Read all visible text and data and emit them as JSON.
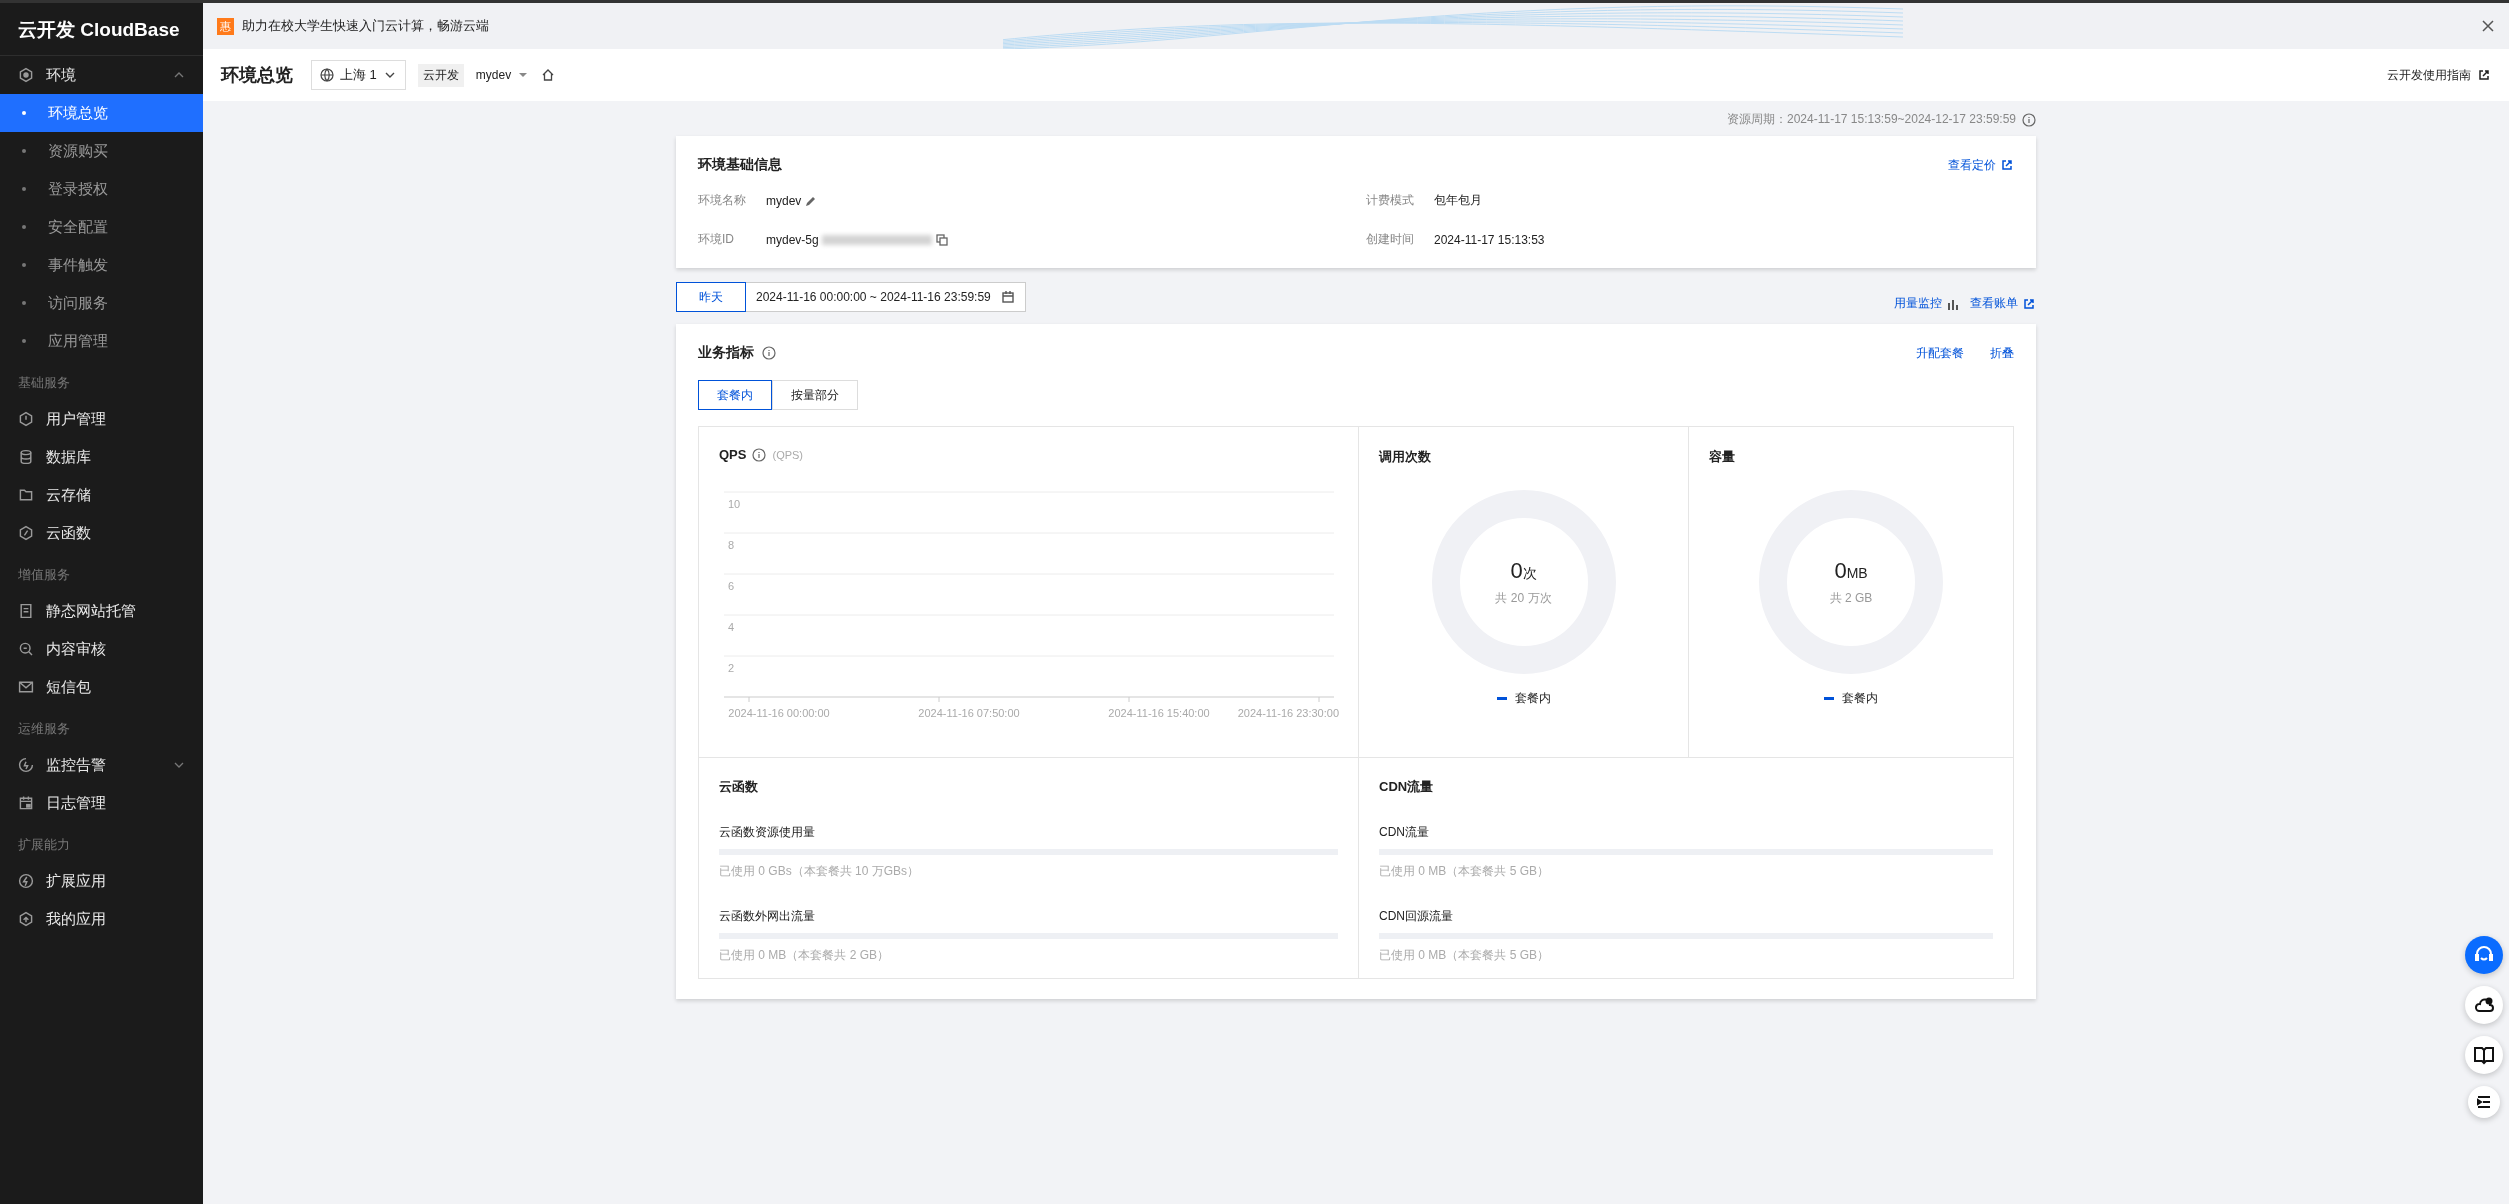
{
  "sidebar": {
    "brand": "云开发 CloudBase",
    "groups": [
      {
        "items": [
          {
            "label": "环境",
            "expanded": true,
            "children": [
              {
                "label": "环境总览",
                "selected": true
              },
              {
                "label": "资源购买",
                "selected": false
              },
              {
                "label": "登录授权",
                "selected": false
              },
              {
                "label": "安全配置",
                "selected": false
              },
              {
                "label": "事件触发",
                "selected": false
              },
              {
                "label": "访问服务",
                "selected": false
              },
              {
                "label": "应用管理",
                "selected": false
              }
            ]
          }
        ]
      },
      {
        "title": "基础服务",
        "items": [
          {
            "label": "用户管理"
          },
          {
            "label": "数据库"
          },
          {
            "label": "云存储"
          },
          {
            "label": "云函数"
          }
        ]
      },
      {
        "title": "增值服务",
        "items": [
          {
            "label": "静态网站托管"
          },
          {
            "label": "内容审核"
          },
          {
            "label": "短信包"
          }
        ]
      },
      {
        "title": "运维服务",
        "items": [
          {
            "label": "监控告警",
            "expanded": false
          },
          {
            "label": "日志管理"
          }
        ]
      },
      {
        "title": "扩展能力",
        "items": [
          {
            "label": "扩展应用"
          },
          {
            "label": "我的应用"
          }
        ]
      }
    ]
  },
  "banner": {
    "badge": "惠",
    "text": "助力在校大学生快速入门云计算，畅游云端"
  },
  "header": {
    "title": "环境总览",
    "region": "上海 1",
    "env_tag": "云开发",
    "env": "mydev",
    "guide_link": "云开发使用指南"
  },
  "resource_period": "资源周期：2024-11-17 15:13:59~2024-12-17 23:59:59",
  "env_card": {
    "title": "环境基础信息",
    "link": "查看定价",
    "fields": [
      {
        "label": "环境名称",
        "value": "mydev",
        "kind": "editable"
      },
      {
        "label": "计费模式",
        "value": "包年包月",
        "kind": "plain"
      },
      {
        "label": "环境ID",
        "value": "mydev-5g",
        "kind": "masked"
      },
      {
        "label": "创建时间",
        "value": "2024-11-17 15:13:53",
        "kind": "plain"
      }
    ]
  },
  "date_bar": {
    "quick": "昨天",
    "range": "2024-11-16 00:00:00 ~ 2024-11-16 23:59:59",
    "links": [
      {
        "label": "用量监控",
        "kind": "chart"
      },
      {
        "label": "查看账单",
        "kind": "external"
      }
    ]
  },
  "metrics": {
    "title": "业务指标",
    "actions": [
      "升配套餐",
      "折叠"
    ],
    "tabs": [
      {
        "label": "套餐内",
        "selected": true
      },
      {
        "label": "按量部分",
        "selected": false
      }
    ],
    "qps": {
      "title": "QPS",
      "unit": "(QPS)",
      "chart_data": {
        "type": "line",
        "grid": true,
        "ylim": [
          0,
          10
        ],
        "yticks": [
          2,
          4,
          6,
          8,
          10
        ],
        "x": [
          "2024-11-16 00:00:00",
          "2024-11-16 07:50:00",
          "2024-11-16 15:40:00",
          "2024-11-16 23:30:00"
        ]
      }
    },
    "donuts": [
      {
        "title": "调用次数",
        "value": "0",
        "unit": "次",
        "total": "共 20 万次",
        "legend": "套餐内"
      },
      {
        "title": "容量",
        "value": "0",
        "unit": "MB",
        "total": "共 2 GB",
        "legend": "套餐内"
      }
    ],
    "usage": [
      {
        "title": "云函数",
        "meters": [
          {
            "label": "云函数资源使用量",
            "level": 0,
            "note": "已使用 0 GBs（本套餐共 10 万GBs）"
          },
          {
            "label": "云函数外网出流量",
            "level": 0,
            "note": "已使用 0 MB（本套餐共 2 GB）"
          }
        ]
      },
      {
        "title": "CDN流量",
        "meters": [
          {
            "label": "CDN流量",
            "level": 0,
            "note": "已使用 0 MB（本套餐共 5 GB）"
          },
          {
            "label": "CDN回源流量",
            "level": 0,
            "note": "已使用 0 MB（本套餐共 5 GB）"
          }
        ]
      }
    ]
  }
}
